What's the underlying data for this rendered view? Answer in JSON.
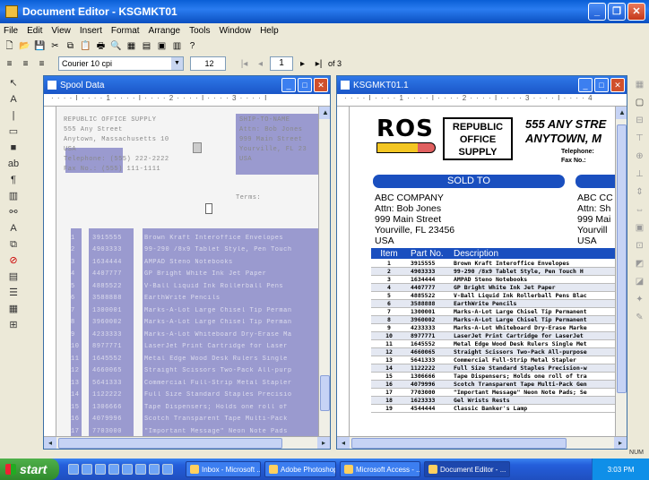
{
  "app": {
    "title": "Document Editor - KSGMKT01"
  },
  "menu": [
    "File",
    "Edit",
    "View",
    "Insert",
    "Format",
    "Arrange",
    "Tools",
    "Window",
    "Help"
  ],
  "toolbar": {
    "font_value": "Courier 10 cpi",
    "size_value": "12",
    "page_value": "1",
    "page_of": "of 3"
  },
  "spool": {
    "title": "Spool Data",
    "ruler": "· · · · I · · · · 1 · · · · I · · · · 2 · · · · I · · · · 3 · · · · I",
    "header_left": [
      "REPUBLIC OFFICE SUPPLY",
      "555 Any Street",
      "Anytown, Massachusetts 10",
      "USA",
      "Telephone: (555) 222-2222",
      "Fax No.: (555) 111-1111"
    ],
    "header_right": [
      "SHIP-TO-NAME",
      "Attn: Bob Jones",
      "999 Main Street",
      "Yourville, FL 23",
      "USA"
    ],
    "extra_label": "Terms:",
    "rows": [
      [
        "1",
        "3915555",
        "Brown Kraft Interoffice Envelopes"
      ],
      [
        "2",
        "4903333",
        "99-290 /8x9 Tablet Style, Pen Touch"
      ],
      [
        "3",
        "1634444",
        "AMPAD Steno Notebooks"
      ],
      [
        "4",
        "4407777",
        "GP Bright White Ink Jet Paper"
      ],
      [
        "5",
        "4885522",
        "V-Ball Liquid Ink Rollerball Pens"
      ],
      [
        "6",
        "3588888",
        "EarthWrite Pencils"
      ],
      [
        "7",
        "1300001",
        "Marks-A-Lot Large Chisel Tip Perman"
      ],
      [
        "8",
        "3960002",
        "Marks-A-Lot Large Chisel Tip Perman"
      ],
      [
        "9",
        "4233333",
        "Marks-A-Lot Whiteboard Dry-Erase Ma"
      ],
      [
        "10",
        "8977771",
        "LaserJet Print Cartridge for Laser"
      ],
      [
        "11",
        "1645552",
        "Metal Edge Wood Desk Rulers Single"
      ],
      [
        "12",
        "4660065",
        "Straight Scissors Two-Pack All-purp"
      ],
      [
        "13",
        "5641333",
        "Commercial Full-Strip Metal Stapler"
      ],
      [
        "14",
        "1122222",
        "Full Size Standard Staples Precisio"
      ],
      [
        "15",
        "1306666",
        "Tape Dispensers; Holds one roll of"
      ],
      [
        "16",
        "4079996",
        "Scotch Transparent Tape Multi-Pack"
      ],
      [
        "17",
        "7703000",
        "\"Important Message\" Neon Note Pads"
      ]
    ]
  },
  "form": {
    "title": "KSGMKT01.1",
    "ruler": "· · · · I · · · · 1 · · · · I · · · · 2 · · · · I · · · · 3 · · · · I · · · · 4",
    "logo_text": "ROS",
    "brand_lines": [
      "REPUBLIC",
      "OFFICE",
      "SUPPLY"
    ],
    "addr_big": [
      "555 ANY STRE",
      "ANYTOWN, M"
    ],
    "tel_label": "Telephone:",
    "fax_label": "Fax No.:",
    "sold_to": "SOLD TO",
    "sold_addr": [
      "ABC COMPANY",
      "Attn: Bob Jones",
      "999 Main Street",
      "Yourville, FL 23456",
      "USA"
    ],
    "ship_addr": [
      "ABC CC",
      "Attn: Sh",
      "999 Mai",
      "Yourvill",
      "USA"
    ],
    "col_item": "Item",
    "col_part": "Part No.",
    "col_desc": "Description",
    "rows": [
      [
        "1",
        "3915555",
        "Brown Kraft Interoffice Envelopes"
      ],
      [
        "2",
        "4903333",
        "99-290 /8x9 Tablet Style, Pen Touch H"
      ],
      [
        "3",
        "1634444",
        "AMPAD Steno Notebooks"
      ],
      [
        "4",
        "4407777",
        "GP Bright White Ink Jet Paper"
      ],
      [
        "5",
        "4885522",
        "V-Ball Liquid Ink Rollerball Pens Blac"
      ],
      [
        "6",
        "3588888",
        "EarthWrite Pencils"
      ],
      [
        "7",
        "1300001",
        "Marks-A-Lot Large Chisel Tip Permanent"
      ],
      [
        "8",
        "3960002",
        "Marks-A-Lot Large Chisel Tip Permanent"
      ],
      [
        "9",
        "4233333",
        "Marks-A-Lot Whiteboard Dry-Erase Marke"
      ],
      [
        "10",
        "8977771",
        "LaserJet Print Cartridge for LaserJet"
      ],
      [
        "11",
        "1645552",
        "Metal Edge Wood Desk Rulers Single Met"
      ],
      [
        "12",
        "4660065",
        "Straight Scissors Two-Pack All-purpose"
      ],
      [
        "13",
        "5641333",
        "Commercial Full-Strip Metal Stapler"
      ],
      [
        "14",
        "1122222",
        "Full Size Standard Staples Precision-w"
      ],
      [
        "15",
        "1306666",
        "Tape Dispensers; Holds one roll of tra"
      ],
      [
        "16",
        "4079996",
        "Scotch Transparent Tape Multi-Pack Gen"
      ],
      [
        "17",
        "7703000",
        "\"Important Message\" Neon Note Pads; Se"
      ],
      [
        "18",
        "1623333",
        "Gel Wrists Rests"
      ],
      [
        "19",
        "4544444",
        "Classic Banker's Lamp"
      ]
    ]
  },
  "status": {
    "num": "NUM"
  },
  "taskbar": {
    "start": "start",
    "tasks": [
      "Inbox - Microsoft ...",
      "Adobe Photoshop",
      "Microsoft Access - ...",
      "Document Editor - ..."
    ],
    "clock": "3:03 PM"
  }
}
